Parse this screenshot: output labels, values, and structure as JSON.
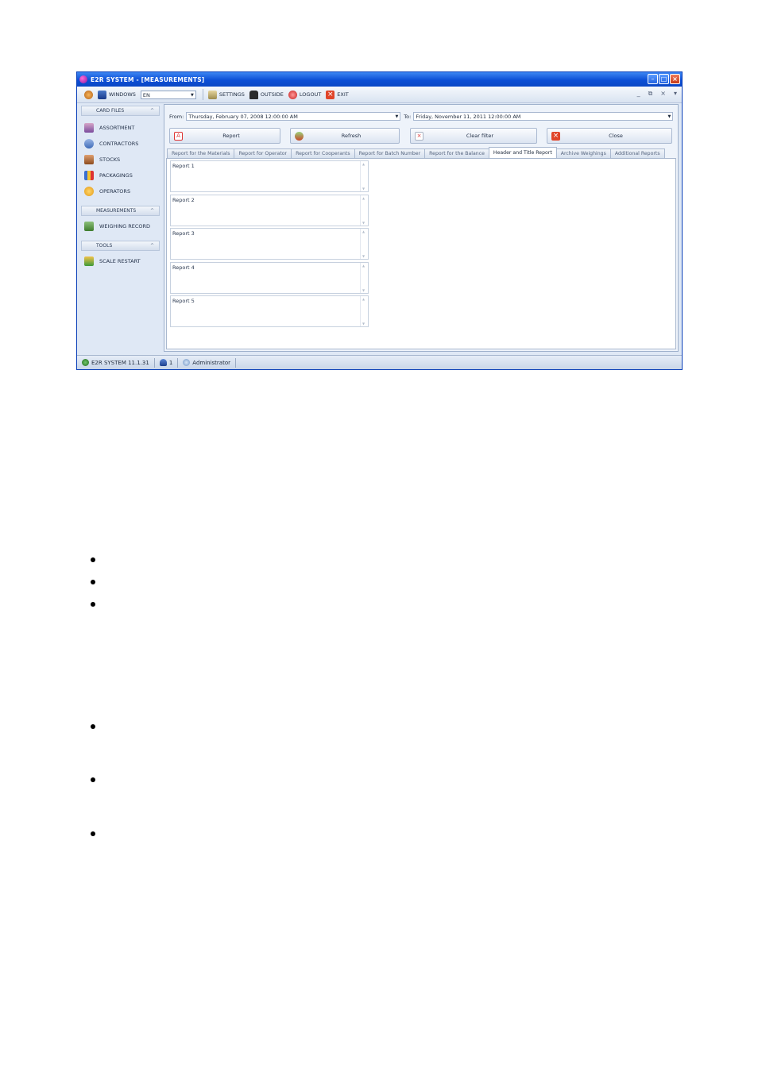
{
  "window": {
    "title": "E2R SYSTEM - [MEASUREMENTS]",
    "controls": [
      "minimize-icon",
      "maximize-icon",
      "close-icon"
    ]
  },
  "toolbar": {
    "windows_label": "WINDOWS",
    "language_value": "EN",
    "settings_label": "SETTINGS",
    "outside_label": "OUTSIDE",
    "logout_label": "LOGOUT",
    "exit_label": "EXIT",
    "mdi_controls": [
      "_",
      "⧉",
      "×",
      "▾"
    ]
  },
  "sidebar": {
    "sections": [
      {
        "title": "CARD FILES",
        "items": [
          "ASSORTMENT",
          "CONTRACTORS",
          "STOCKS",
          "PACKAGINGS",
          "OPERATORS"
        ]
      },
      {
        "title": "MEASUREMENTS",
        "items": [
          "WEIGHING RECORD"
        ]
      },
      {
        "title": "TOOLS",
        "items": [
          "SCALE RESTART"
        ]
      }
    ]
  },
  "filter": {
    "from_label": "From:",
    "from_value": "Thursday, February 07, 2008 12:00:00 AM",
    "to_label": "To:",
    "to_value": "Friday, November 11, 2011 12:00:00 AM"
  },
  "actions": {
    "report": "Report",
    "refresh": "Refresh",
    "clear_filter": "Clear filter",
    "close": "Close"
  },
  "tabs": [
    "Report for the Materials",
    "Report for Operator",
    "Report for Cooperants",
    "Report for Batch Number",
    "Report for the Balance",
    "Header and Title Report",
    "Archive Weighings",
    "Additional Reports"
  ],
  "active_tab": "Header and Title Report",
  "reports": [
    "Report 1",
    "Report 2",
    "Report 3",
    "Report 4",
    "Report 5"
  ],
  "status": {
    "version": "E2R SYSTEM 11.1.31",
    "user_count": "1",
    "user": "Administrator"
  },
  "colors": {
    "title_bar": "#0c4fd6",
    "window_bg": "#dfe8f5",
    "accent": "#0a3fb8"
  }
}
